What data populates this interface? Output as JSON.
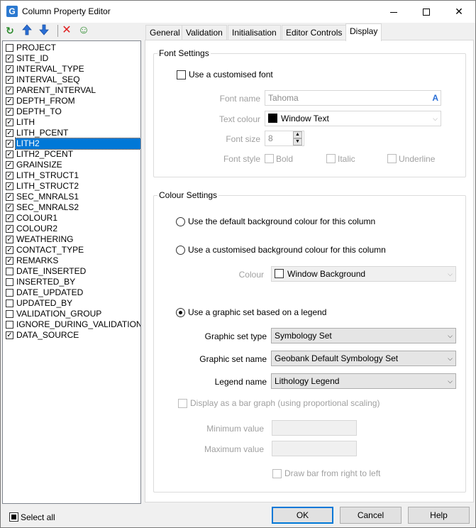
{
  "window": {
    "title": "Column Property Editor",
    "app_icon_letter": "G"
  },
  "toolbar": {
    "refresh_icon": "↻",
    "up_icon": "🡅",
    "down_icon": "🡇",
    "delete_icon": "✕",
    "user_icon": "☺"
  },
  "columns": [
    {
      "name": "PROJECT",
      "checked": false
    },
    {
      "name": "SITE_ID",
      "checked": true
    },
    {
      "name": "INTERVAL_TYPE",
      "checked": true
    },
    {
      "name": "INTERVAL_SEQ",
      "checked": true
    },
    {
      "name": "PARENT_INTERVAL",
      "checked": true
    },
    {
      "name": "DEPTH_FROM",
      "checked": true
    },
    {
      "name": "DEPTH_TO",
      "checked": true
    },
    {
      "name": "LITH",
      "checked": true
    },
    {
      "name": "LITH_PCENT",
      "checked": true
    },
    {
      "name": "LITH2",
      "checked": true,
      "selected": true
    },
    {
      "name": "LITH2_PCENT",
      "checked": true
    },
    {
      "name": "GRAINSIZE",
      "checked": true
    },
    {
      "name": "LITH_STRUCT1",
      "checked": true
    },
    {
      "name": "LITH_STRUCT2",
      "checked": true
    },
    {
      "name": "SEC_MNRALS1",
      "checked": true
    },
    {
      "name": "SEC_MNRALS2",
      "checked": true
    },
    {
      "name": "COLOUR1",
      "checked": true
    },
    {
      "name": "COLOUR2",
      "checked": true
    },
    {
      "name": "WEATHERING",
      "checked": true
    },
    {
      "name": "CONTACT_TYPE",
      "checked": true
    },
    {
      "name": "REMARKS",
      "checked": true
    },
    {
      "name": "DATE_INSERTED",
      "checked": false
    },
    {
      "name": "INSERTED_BY",
      "checked": false
    },
    {
      "name": "DATE_UPDATED",
      "checked": false
    },
    {
      "name": "UPDATED_BY",
      "checked": false
    },
    {
      "name": "VALIDATION_GROUP",
      "checked": false
    },
    {
      "name": "IGNORE_DURING_VALIDATION",
      "checked": false
    },
    {
      "name": "DATA_SOURCE",
      "checked": true
    }
  ],
  "tabs": [
    {
      "label": "General"
    },
    {
      "label": "Validation"
    },
    {
      "label": "Initialisation"
    },
    {
      "label": "Editor Controls"
    },
    {
      "label": "Display",
      "active": true
    }
  ],
  "font_settings": {
    "title": "Font Settings",
    "use_custom_font": "Use a customised font",
    "font_name_label": "Font name",
    "font_name_value": "Tahoma",
    "text_colour_label": "Text colour",
    "text_colour_value": "Window Text",
    "font_size_label": "Font size",
    "font_size_value": "8",
    "font_style_label": "Font style",
    "bold": "Bold",
    "italic": "Italic",
    "underline": "Underline"
  },
  "colour_settings": {
    "title": "Colour Settings",
    "option_default": "Use the default background colour for this column",
    "option_custom": "Use a customised background colour for this column",
    "colour_label": "Colour",
    "colour_value": "Window Background",
    "option_graphic": "Use a graphic set based on a legend",
    "graphic_type_label": "Graphic set type",
    "graphic_type_value": "Symbology Set",
    "graphic_name_label": "Graphic set name",
    "graphic_name_value": "Geobank Default Symbology Set",
    "legend_name_label": "Legend name",
    "legend_name_value": "Lithology Legend",
    "bar_graph": "Display as a bar graph (using proportional scaling)",
    "min_label": "Minimum value",
    "max_label": "Maximum value",
    "right_to_left": "Draw bar from right to left"
  },
  "footer": {
    "select_all": "Select all",
    "ok": "OK",
    "cancel": "Cancel",
    "help": "Help"
  },
  "colors": {
    "accent": "#0078d7",
    "text_colour_swatch": "#000000",
    "window_bg_swatch": "#ffffff"
  }
}
